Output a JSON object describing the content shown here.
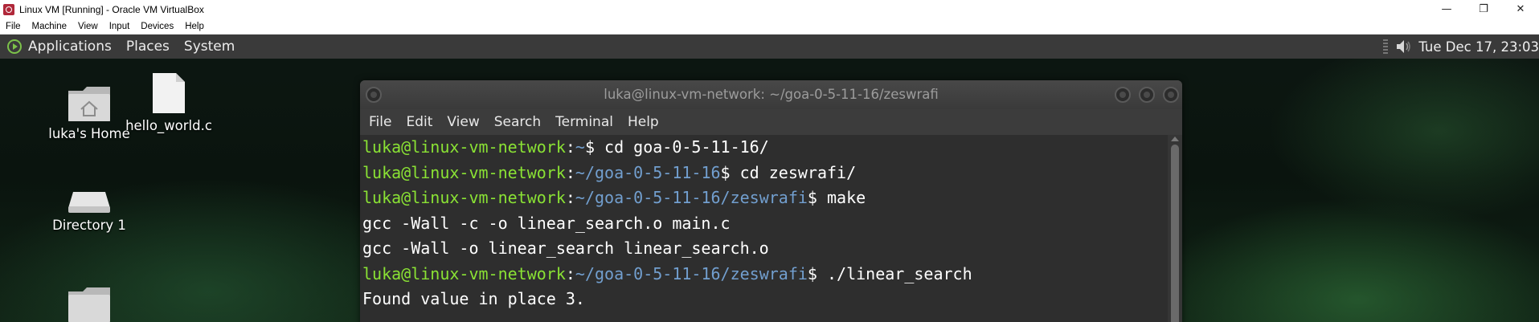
{
  "host": {
    "title": "Linux VM [Running] - Oracle VM VirtualBox",
    "menu": [
      "File",
      "Machine",
      "View",
      "Input",
      "Devices",
      "Help"
    ],
    "window_buttons": {
      "minimize": "—",
      "restore": "❐",
      "close": "✕"
    }
  },
  "panel": {
    "menus": [
      "Applications",
      "Places",
      "System"
    ],
    "clock": "Tue Dec 17, 23:03"
  },
  "desktop_icons": [
    {
      "label": "luka's Home",
      "icon": "home-folder-icon"
    },
    {
      "label": "hello_world.c",
      "icon": "text-file-icon"
    },
    {
      "label": "Directory 1",
      "icon": "drive-icon"
    },
    {
      "label": "",
      "icon": "folder-icon"
    }
  ],
  "terminal": {
    "title": "luka@linux-vm-network: ~/goa-0-5-11-16/zeswrafi",
    "menu": [
      "File",
      "Edit",
      "View",
      "Search",
      "Terminal",
      "Help"
    ],
    "lines": [
      {
        "user": "luka@linux-vm-network",
        "sep": ":",
        "path": "~",
        "rest": "$ cd goa-0-5-11-16/"
      },
      {
        "user": "luka@linux-vm-network",
        "sep": ":",
        "path": "~/goa-0-5-11-16",
        "rest": "$ cd zeswrafi/"
      },
      {
        "user": "luka@linux-vm-network",
        "sep": ":",
        "path": "~/goa-0-5-11-16/zeswrafi",
        "rest": "$ make"
      },
      {
        "text": "gcc -Wall -c -o linear_search.o main.c"
      },
      {
        "text": "gcc -Wall -o linear_search linear_search.o"
      },
      {
        "user": "luka@linux-vm-network",
        "sep": ":",
        "path": "~/goa-0-5-11-16/zeswrafi",
        "rest": "$ ./linear_search"
      },
      {
        "text": "Found value in place 3."
      }
    ]
  },
  "colors": {
    "prompt_user": "#8ae234",
    "prompt_path": "#729fcf",
    "panel_bg": "#3a3a3a",
    "terminal_bg": "#2e2e2e"
  }
}
